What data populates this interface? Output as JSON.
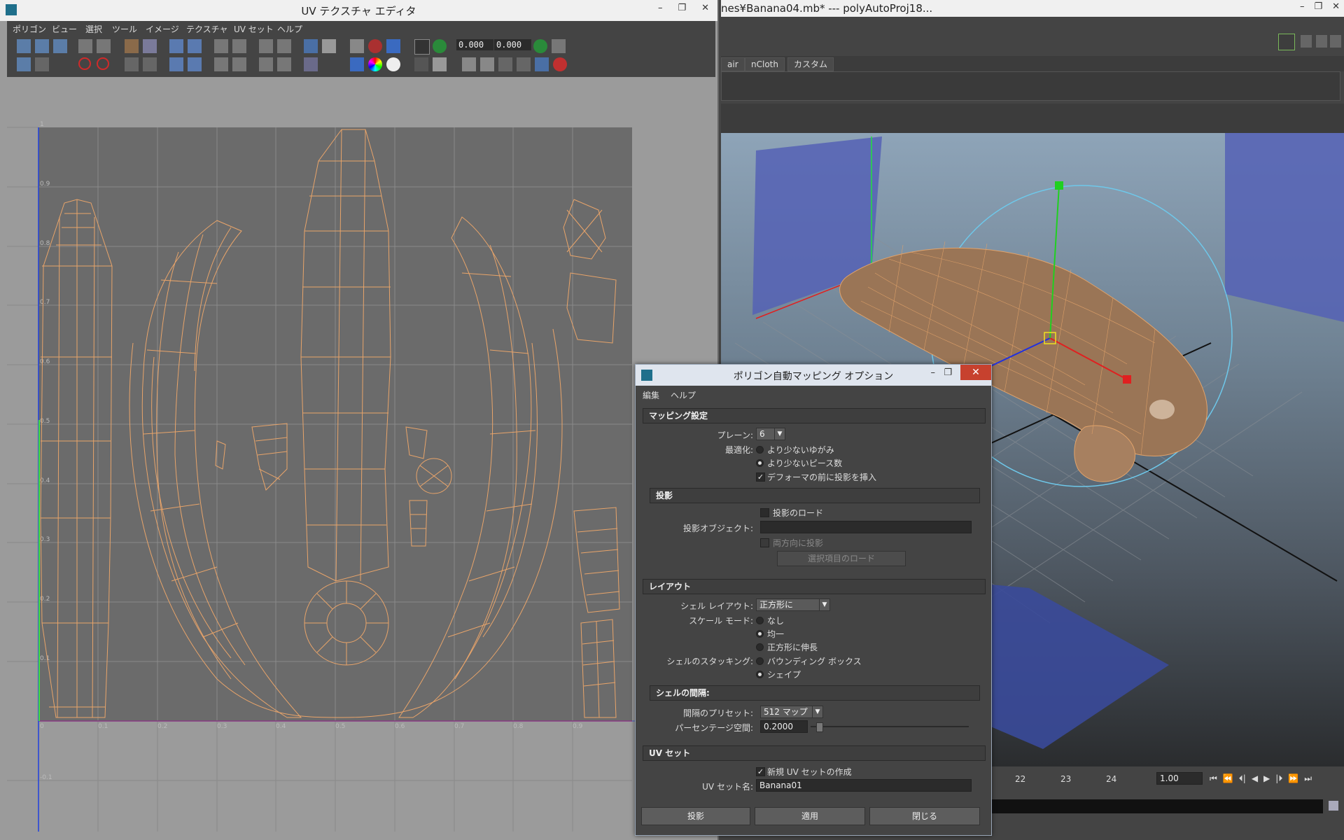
{
  "maya": {
    "title": "nes¥Banana04.mb*   ---   polyAutoProj18...",
    "window_buttons": [
      "–",
      "❐",
      "✕"
    ],
    "shelf_tabs": [
      "air",
      "nCloth",
      "カスタム"
    ],
    "timeline": {
      "ticks": [
        "22",
        "23",
        "24"
      ],
      "current_frame": "1.00"
    },
    "playback_buttons": [
      "⏮",
      "⏪",
      "⏴|",
      "◀",
      "▶",
      "|⏵",
      "⏩",
      "⏭"
    ]
  },
  "uv_editor": {
    "title": "UV テクスチャ エディタ",
    "window_buttons": [
      "–",
      "❐",
      "✕"
    ],
    "menus": [
      "ポリゴン",
      "ビュー",
      "選択",
      "ツール",
      "イメージ",
      "テクスチャ",
      "UV セット",
      "ヘルプ"
    ],
    "u_value": "0.000",
    "v_value": "0.000",
    "axis_labels_u": [
      "0",
      "0.1",
      "0.2",
      "0.3",
      "0.4",
      "0.5",
      "0.6",
      "0.7",
      "0.8",
      "0.9"
    ],
    "axis_labels_v": [
      "1",
      "0.9",
      "0.8",
      "0.7",
      "0.6",
      "0.5",
      "0.4",
      "0.3",
      "0.2",
      "0.1",
      "-0.1"
    ],
    "colors": {
      "uv_wire": "#e8a46a",
      "u_axis": "#e23030",
      "v_axis": "#2040e0",
      "canvas_bg": "#6b6b6b",
      "outside_bg": "#9b9b9b"
    }
  },
  "dialog": {
    "title": "ポリゴン自動マッピング オプション",
    "menus": [
      "編集",
      "ヘルプ"
    ],
    "mapping": {
      "header": "マッピング設定",
      "planes_label": "プレーン:",
      "planes_value": "6",
      "optimize_label": "最適化:",
      "optimize_opt1": "より少ないゆがみ",
      "optimize_opt2": "より少ないピース数",
      "insert_before_deformers": "デフォーマの前に投影を挿入"
    },
    "projection": {
      "header": "投影",
      "load_projection": "投影のロード",
      "projection_object_label": "投影オブジェクト:",
      "both_directions": "両方向に投影",
      "load_selected": "選択項目のロード"
    },
    "layout": {
      "header": "レイアウト",
      "shell_layout_label": "シェル レイアウト:",
      "shell_layout_value": "正方形に",
      "scale_mode_label": "スケール モード:",
      "scale_none": "なし",
      "scale_uniform": "均一",
      "scale_stretch": "正方形に伸長",
      "stacking_label": "シェルのスタッキング:",
      "stacking_bbox": "バウンディング ボックス",
      "stacking_shape": "シェイプ"
    },
    "spacing": {
      "header": "シェルの間隔:",
      "preset_label": "間隔のプリセット:",
      "preset_value": "512 マップ",
      "percentage_label": "パーセンテージ空間:",
      "percentage_value": "0.2000"
    },
    "uvset": {
      "header": "UV セット",
      "create_new": "新規 UV セットの作成",
      "name_label": "UV セット名:",
      "name_value": "Banana01"
    },
    "buttons": {
      "project": "投影",
      "apply": "適用",
      "close": "閉じる"
    }
  }
}
